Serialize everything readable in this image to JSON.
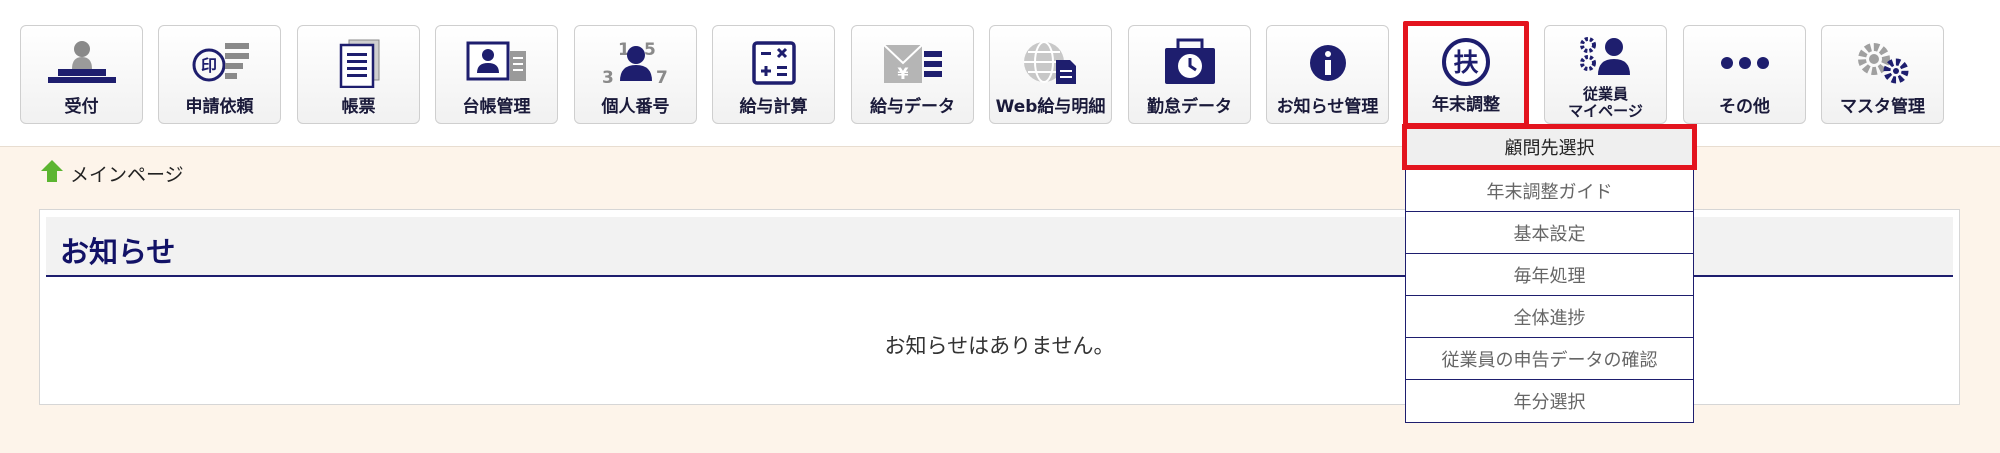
{
  "toolbar": {
    "tiles": [
      {
        "label": "受付",
        "icon": "reception-stamp-icon"
      },
      {
        "label": "申請依頼",
        "icon": "application-request-icon"
      },
      {
        "label": "帳票",
        "icon": "forms-icon"
      },
      {
        "label": "台帳管理",
        "icon": "ledger-management-icon"
      },
      {
        "label": "個人番号",
        "icon": "personal-number-icon"
      },
      {
        "label": "給与計算",
        "icon": "calculator-icon"
      },
      {
        "label": "給与データ",
        "icon": "payroll-data-icon"
      },
      {
        "label": "Web給与明細",
        "icon": "web-payslip-icon"
      },
      {
        "label": "勤怠データ",
        "icon": "attendance-data-icon"
      },
      {
        "label": "お知らせ管理",
        "icon": "info-icon"
      },
      {
        "label": "年末調整",
        "icon": "fu-circle-icon",
        "icon_char": "扶"
      },
      {
        "label_line1": "従業員",
        "label_line2": "マイページ",
        "icon": "employee-mypage-icon"
      },
      {
        "label": "その他",
        "icon": "more-dots-icon"
      },
      {
        "label": "マスタ管理",
        "icon": "gears-icon"
      }
    ]
  },
  "breadcrumb": {
    "label": "メインページ",
    "icon": "home-arrow-icon"
  },
  "notice": {
    "title": "お知らせ",
    "empty_message": "お知らせはありません。"
  },
  "dropdown": {
    "items": [
      {
        "label": "顧問先選択"
      },
      {
        "label": "年末調整ガイド"
      },
      {
        "label": "基本設定"
      },
      {
        "label": "毎年処理"
      },
      {
        "label": "全体進捗"
      },
      {
        "label": "従業員の申告データの確認"
      },
      {
        "label": "年分選択"
      }
    ]
  },
  "colors": {
    "navy": "#1e1e6e",
    "highlight_red": "#e3141e",
    "page_bg": "#fdf4ea",
    "home_green": "#5cb531"
  }
}
